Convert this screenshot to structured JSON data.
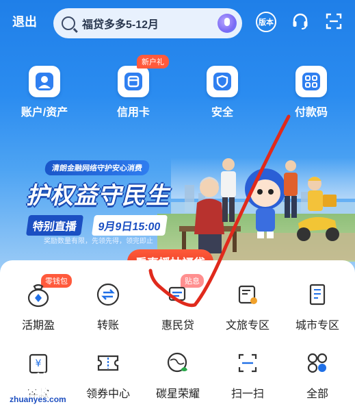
{
  "header": {
    "back_label": "退出",
    "search_text": "福贷多多5-12月",
    "version_label": "版本"
  },
  "quick_actions": [
    {
      "label": "账户/资产",
      "icon": "account-icon",
      "badge": ""
    },
    {
      "label": "信用卡",
      "icon": "credit-card-icon",
      "badge": "新户礼"
    },
    {
      "label": "安全",
      "icon": "shield-icon",
      "badge": ""
    },
    {
      "label": "付款码",
      "icon": "payment-code-icon",
      "badge": ""
    }
  ],
  "banner": {
    "tagline": "清朗金融网络守护安心消费",
    "headline": "护权益守民生",
    "live_label": "特别直播",
    "live_time": "9月9日15:00",
    "notice": "奖励数量有限，先领先得，领完即止",
    "cta": "看直播抽福袋"
  },
  "menu": [
    {
      "label": "活期盈",
      "icon": "wallet-pouch-icon",
      "badge": "零钱包"
    },
    {
      "label": "转账",
      "icon": "transfer-icon",
      "badge": ""
    },
    {
      "label": "惠民贷",
      "icon": "loan-icon",
      "badge": "贴息"
    },
    {
      "label": "文旅专区",
      "icon": "travel-icon",
      "badge": ""
    },
    {
      "label": "城市专区",
      "icon": "city-icon",
      "badge": ""
    },
    {
      "label": "存款",
      "icon": "deposit-icon",
      "badge": ""
    },
    {
      "label": "领券中心",
      "icon": "coupon-icon",
      "badge": ""
    },
    {
      "label": "碳星荣耀",
      "icon": "globe-leaf-icon",
      "badge": ""
    },
    {
      "label": "扫一扫",
      "icon": "scan-icon",
      "badge": ""
    },
    {
      "label": "全部",
      "icon": "grid-icon",
      "badge": ""
    }
  ],
  "watermark": {
    "main": "好赚网",
    "sub": "zhuanyes.com"
  },
  "colors": {
    "primary_blue": "#2b8cf0",
    "accent_red": "#e3331f",
    "badge_orange": "#ff5a3c"
  }
}
